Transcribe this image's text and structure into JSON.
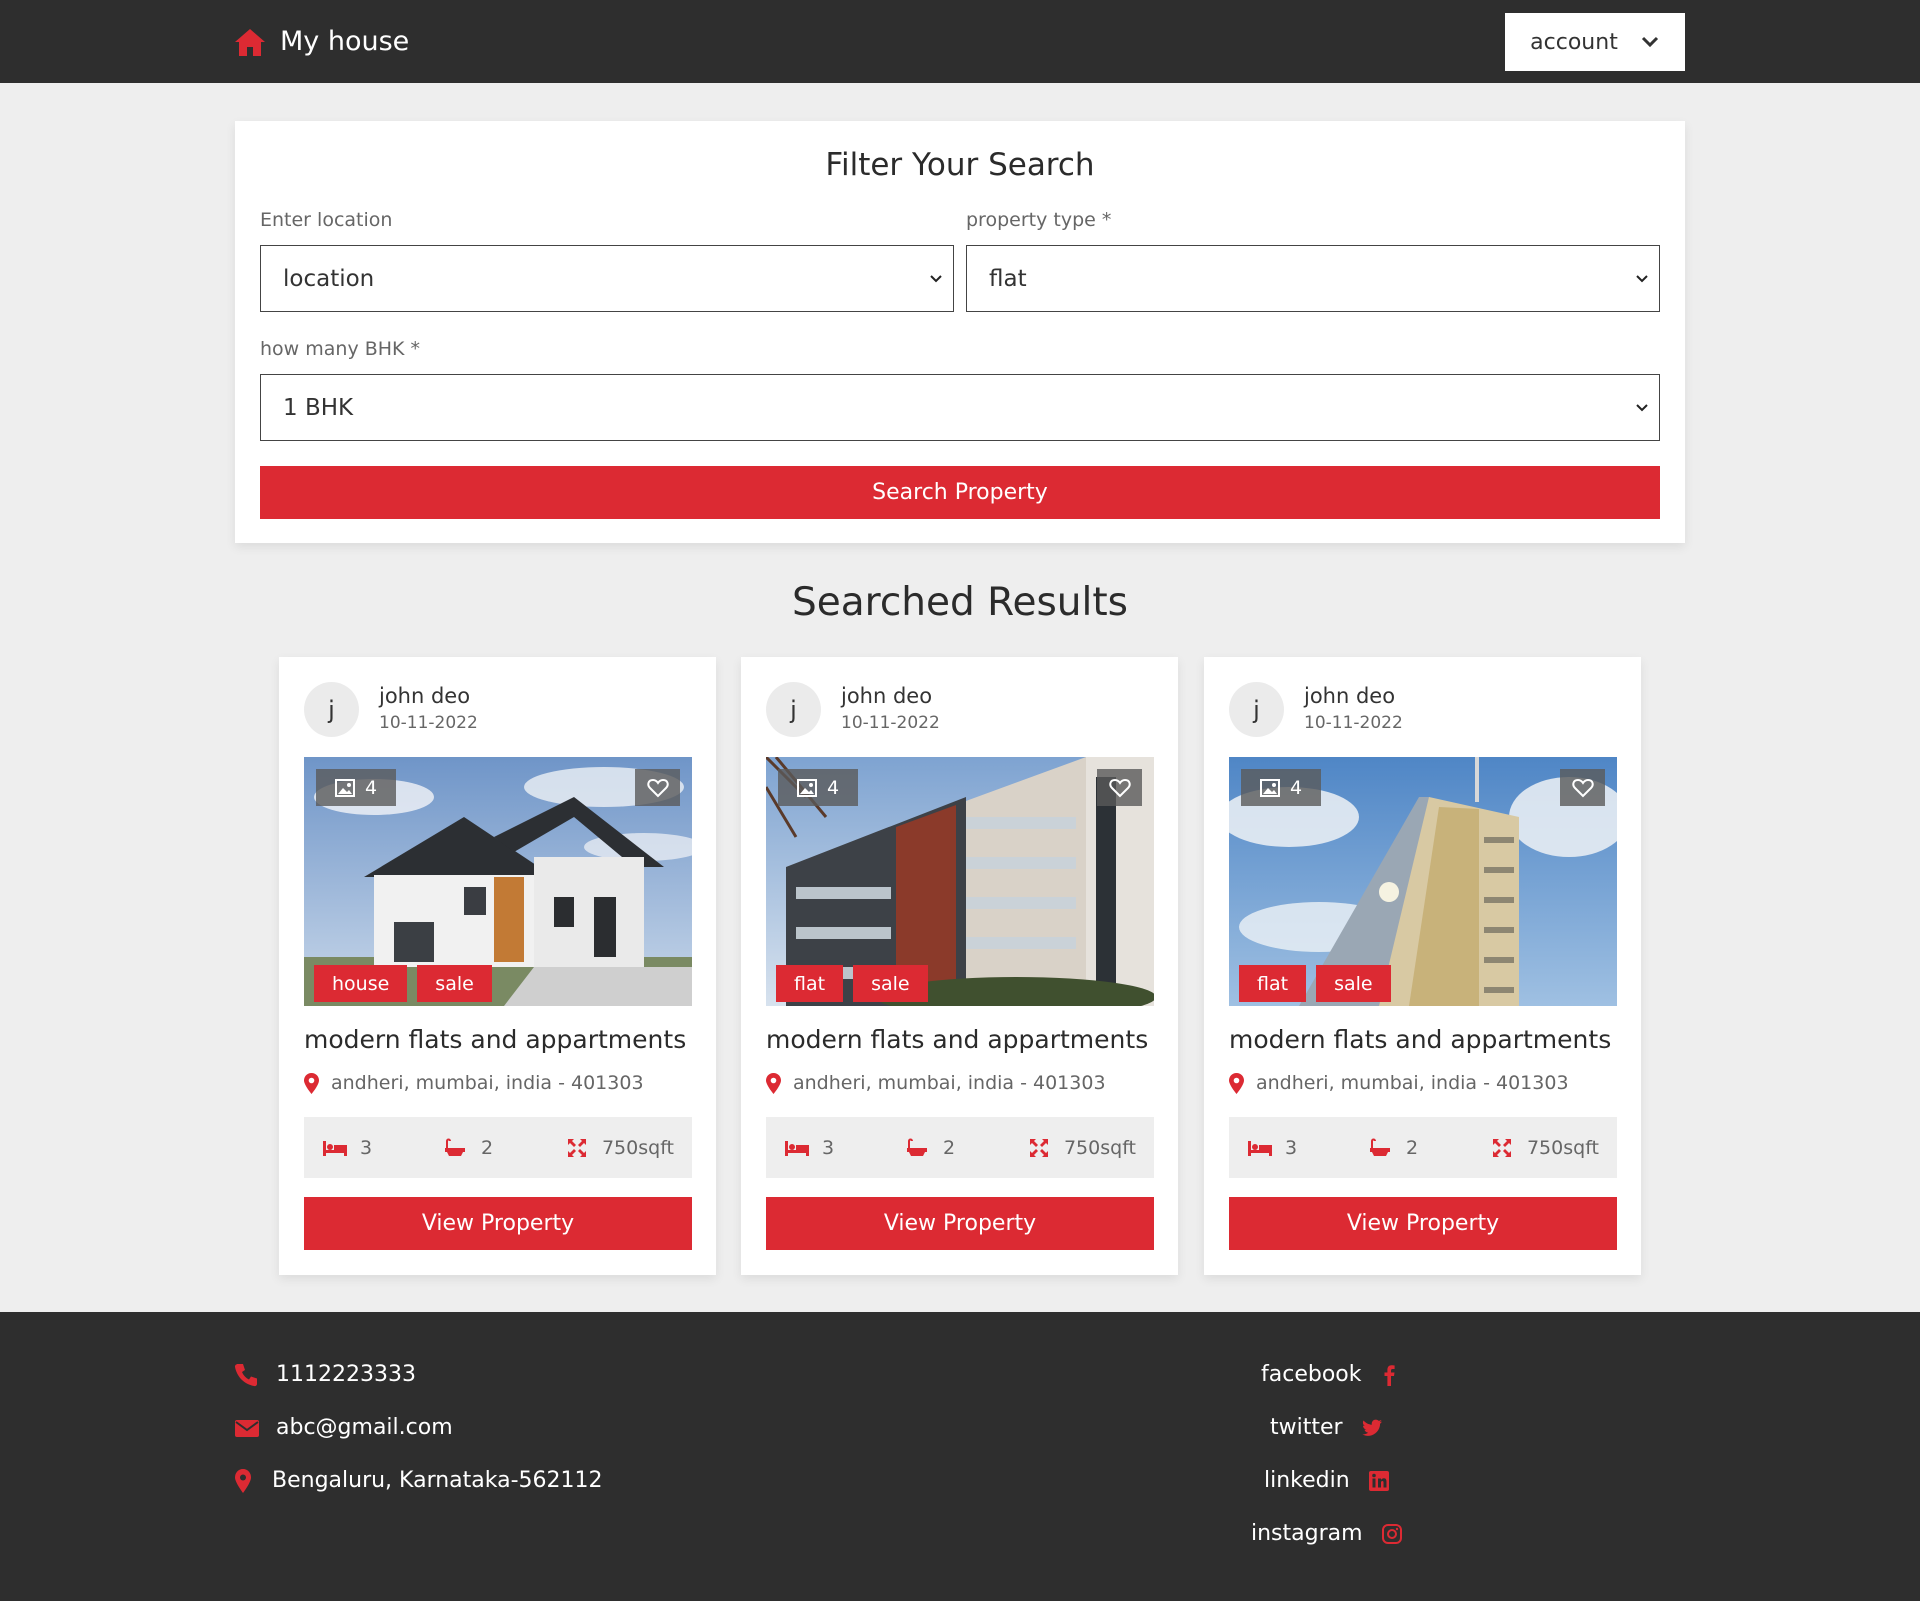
{
  "header": {
    "brand": "My house",
    "account_label": "account"
  },
  "filter": {
    "title": "Filter Your Search",
    "location_label": "Enter location",
    "location_value": "location",
    "type_label": "property type *",
    "type_value": "flat",
    "bhk_label": "how many BHK *",
    "bhk_value": "1 BHK",
    "search_label": "Search Property"
  },
  "results_title": "Searched Results",
  "cards": [
    {
      "initial": "j",
      "author": "john deo",
      "date": "10-11-2022",
      "image_count": "4",
      "tags": [
        "house",
        "sale"
      ],
      "title": "modern flats and appartments",
      "address": "andheri, mumbai, india - 401303",
      "beds": "3",
      "baths": "2",
      "area": "750sqft",
      "button": "View Property"
    },
    {
      "initial": "j",
      "author": "john deo",
      "date": "10-11-2022",
      "image_count": "4",
      "tags": [
        "flat",
        "sale"
      ],
      "title": "modern flats and appartments",
      "address": "andheri, mumbai, india - 401303",
      "beds": "3",
      "baths": "2",
      "area": "750sqft",
      "button": "View Property"
    },
    {
      "initial": "j",
      "author": "john deo",
      "date": "10-11-2022",
      "image_count": "4",
      "tags": [
        "flat",
        "sale"
      ],
      "title": "modern flats and appartments",
      "address": "andheri, mumbai, india - 401303",
      "beds": "3",
      "baths": "2",
      "area": "750sqft",
      "button": "View Property"
    }
  ],
  "footer": {
    "phone": "1112223333",
    "email": "abc@gmail.com",
    "address": "Bengaluru, Karnataka-562112",
    "social": [
      "facebook",
      "twitter",
      "linkedin",
      "instagram"
    ]
  },
  "colors": {
    "accent": "#dc2a33",
    "dark": "#2e2e2e",
    "background": "#eeeeee"
  },
  "icons": {
    "brand": "home-icon",
    "account": "chevron-down-icon",
    "images": "image-icon",
    "favorite": "heart-icon",
    "location": "map-pin-icon",
    "beds": "bed-icon",
    "baths": "bath-icon",
    "area": "expand-icon",
    "phone": "phone-icon",
    "email": "envelope-icon",
    "facebook": "facebook-icon",
    "twitter": "twitter-icon",
    "linkedin": "linkedin-icon",
    "instagram": "instagram-icon"
  }
}
